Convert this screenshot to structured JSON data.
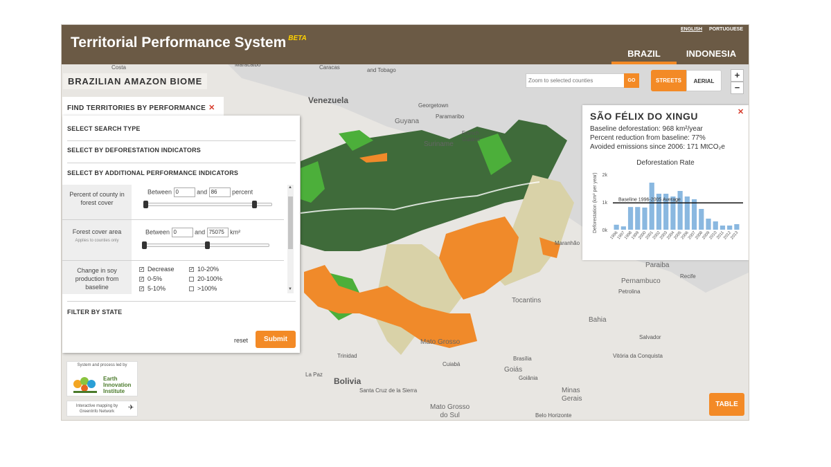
{
  "header": {
    "title": "Territorial Performance System",
    "beta": "BETA",
    "languages": [
      "ENGLISH",
      "PORTUGUESE"
    ],
    "country_tabs": [
      "BRAZIL",
      "INDONESIA"
    ],
    "active_country": "BRAZIL"
  },
  "biome_label": "BRAZILIAN AMAZON BIOME",
  "find_panel": {
    "title": "FIND TERRITORIES BY PERFORMANCE",
    "close": "✕",
    "sections": {
      "search_type": "SELECT SEARCH TYPE",
      "deforestation": "SELECT BY DEFORESTATION INDICATORS",
      "additional": "SELECT BY ADDITIONAL PERFORMANCE INDICATORS",
      "state": "FILTER BY STATE"
    },
    "forest_cover_percent": {
      "label": "Percent of county in forest cover",
      "between": "Between",
      "and": "and",
      "min": "0",
      "max": "86",
      "unit": "percent",
      "range_min": 0,
      "range_max": 100
    },
    "forest_cover_area": {
      "label": "Forest cover area",
      "note": "Applies to counties only",
      "between": "Between",
      "and": "and",
      "min": "0",
      "max": "75075",
      "unit": "km²",
      "range_max": 150000
    },
    "soy_change": {
      "label": "Change in soy production from baseline",
      "options": [
        {
          "label": "Decrease",
          "checked": true
        },
        {
          "label": "10-20%",
          "checked": true
        },
        {
          "label": "0-5%",
          "checked": true
        },
        {
          "label": "20-100%",
          "checked": false
        },
        {
          "label": "5-10%",
          "checked": true
        },
        {
          "label": ">100%",
          "checked": false
        }
      ]
    },
    "reset_label": "reset",
    "submit_label": "Submit"
  },
  "zoom_search": {
    "placeholder": "Zoom to selected counties",
    "go_label": "GO"
  },
  "basemap": {
    "streets_label": "STREETS",
    "aerial_label": "AERIAL",
    "active": "STREETS"
  },
  "zoom_controls": {
    "in": "+",
    "out": "−"
  },
  "detail": {
    "title": "SÃO FÉLIX DO XINGU",
    "baseline_text": "Baseline deforestation: 968 km²/year",
    "reduction_text": "Percent reduction from baseline: 77%",
    "emissions_text": "Avoided emissions since 2006: 171 MtCO₂e",
    "close": "✕"
  },
  "chart_data": {
    "type": "bar",
    "title": "Deforestation Rate",
    "ylabel": "Deforestation (km² per year)",
    "xlabel": "",
    "ylim": [
      0,
      2000
    ],
    "yticks": [
      "0k",
      "1k",
      "2k"
    ],
    "categories": [
      "1996",
      "1997",
      "1998",
      "1999",
      "2000",
      "2001",
      "2002",
      "2003",
      "2004",
      "2005",
      "2006",
      "2007",
      "2008",
      "2009",
      "2010",
      "2011",
      "2012",
      "2013"
    ],
    "values": [
      180,
      120,
      820,
      820,
      800,
      1700,
      1300,
      1300,
      1200,
      1400,
      1200,
      1100,
      750,
      400,
      300,
      150,
      150,
      200
    ],
    "baseline": {
      "label": "Baseline 1996-2005 Average",
      "value": 968
    },
    "bar_color": "#8ab8e0"
  },
  "map_places": {
    "costa": "Costa",
    "maracaibo": "Maracaibo",
    "caracas": "Caracas",
    "tobago": "and Tobago",
    "venezuela": "Venezuela",
    "georgetown": "Georgetown",
    "guyana": "Guyana",
    "paramaribo": "Paramaribo",
    "suriname": "Suriname",
    "french_guiana": "French\nGuiana",
    "maranhao": "Maranhão",
    "paraiba": "Paraiba",
    "pernambuco": "Pernambuco",
    "recife": "Recife",
    "petrolina": "Petrolina",
    "tocantins": "Tocantins",
    "bahia": "Bahia",
    "salvador": "Salvador",
    "vitoria": "Vitória da Conquista",
    "trinidad": "Trinidad",
    "cuiaba": "Cuiabá",
    "la_paz": "La Paz",
    "bolivia": "Bolivia",
    "goias": "Goiás",
    "goiania": "Goiânia",
    "brasilia": "Brasília",
    "santa_cruz": "Santa Cruz de la Sierra",
    "minas_gerais": "Minas\nGerais",
    "mato_grosso": "Mato Grosso",
    "mato_grosso_do_sul": "Mato Grosso\ndo Sul",
    "belo_horizonte": "Belo Horizonte"
  },
  "logos": {
    "led_by": "System and process led by",
    "eii_name": "Earth\nInnovation\nInstitute",
    "greeninfo": "Interactive mapping by GreenInfo Network"
  },
  "table_button": "TABLE",
  "colors": {
    "header": "#6b5a45",
    "accent": "#f38a26",
    "forest_dark": "#3f6b3a",
    "forest_green": "#4caf3a",
    "orange_region": "#f08a2a"
  }
}
